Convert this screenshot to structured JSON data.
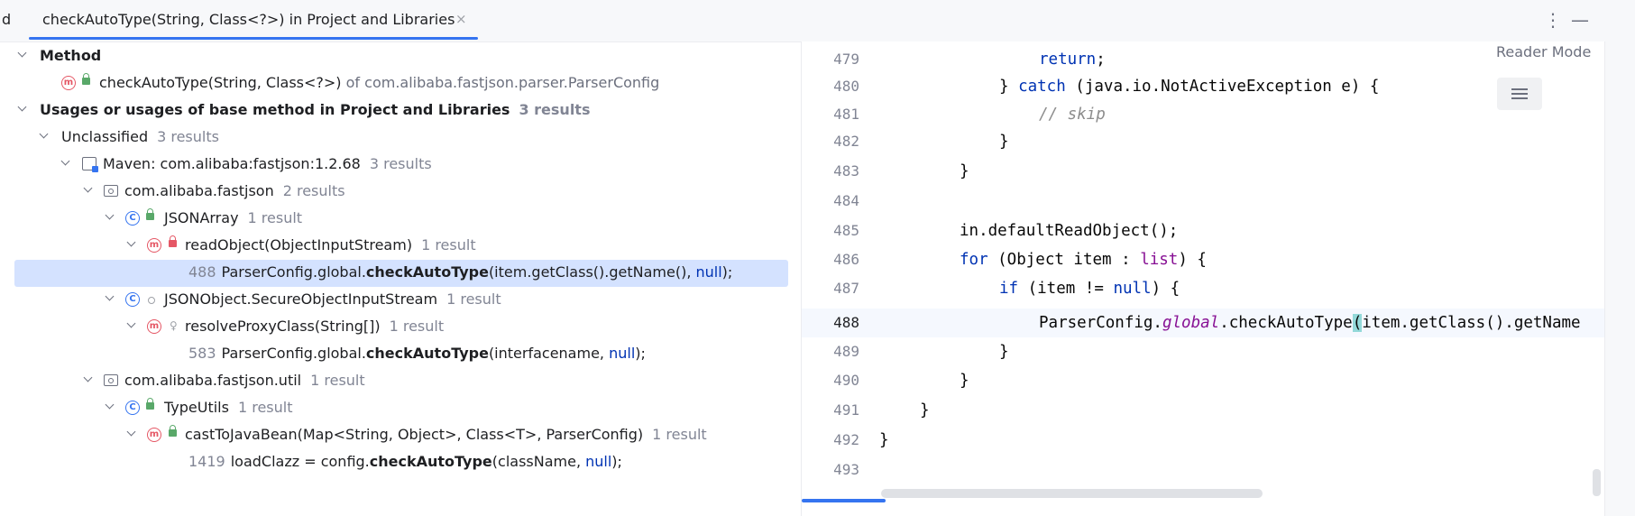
{
  "tab": {
    "prefix": "d",
    "title": "checkAutoType(String, Class<?>) in Project and Libraries",
    "close": "×"
  },
  "toolbar": {
    "more": "⋮",
    "minimize": "—"
  },
  "tree": {
    "method_header": "Method",
    "method_name": "checkAutoType(String, Class<?>)",
    "method_of": "of com.alibaba.fastjson.parser.ParserConfig",
    "usages_header": "Usages or usages of base method in Project and Libraries",
    "usages_count": "3 results",
    "unclassified": "Unclassified",
    "unclassified_count": "3 results",
    "maven": "Maven: com.alibaba:fastjson:1.2.68",
    "maven_count": "3 results",
    "pkg1": "com.alibaba.fastjson",
    "pkg1_count": "2 results",
    "class1": "JSONArray",
    "class1_count": "1 result",
    "method1": "readObject(ObjectInputStream)",
    "method1_count": "1 result",
    "usage1_line": "488",
    "usage1_pre": "ParserConfig.global.",
    "usage1_call": "checkAutoType",
    "usage1_args": "(item.getClass().getName(), ",
    "usage1_null": "null",
    "usage1_end": ");",
    "class2": "JSONObject.SecureObjectInputStream",
    "class2_count": "1 result",
    "method2": "resolveProxyClass(String[])",
    "method2_count": "1 result",
    "usage2_line": "583",
    "usage2_pre": "ParserConfig.global.",
    "usage2_call": "checkAutoType",
    "usage2_args": "(interfacename, ",
    "usage2_null": "null",
    "usage2_end": ");",
    "pkg2": "com.alibaba.fastjson.util",
    "pkg2_count": "1 result",
    "class3": "TypeUtils",
    "class3_count": "1 result",
    "method3": "castToJavaBean(Map<String, Object>, Class<T>, ParserConfig)",
    "method3_count": "1 result",
    "usage3_line": "1419",
    "usage3_pre": "loadClazz = config.",
    "usage3_call": "checkAutoType",
    "usage3_args": "(className, ",
    "usage3_null": "null",
    "usage3_end": ");"
  },
  "editor": {
    "reader_mode": "Reader Mode",
    "lines": [
      "479",
      "480",
      "481",
      "482",
      "483",
      "484",
      "485",
      "486",
      "487",
      "488",
      "489",
      "490",
      "491",
      "492",
      "493"
    ],
    "current_line": "488",
    "code": {
      "l479_a": "return",
      "l479_b": ";",
      "l480_a": "} ",
      "l480_b": "catch",
      "l480_c": " (java.io.NotActiveException e) {",
      "l481": "// skip",
      "l482": "}",
      "l483": "}",
      "l485": "in.defaultReadObject();",
      "l486_a": "for",
      "l486_b": " (Object item : ",
      "l486_c": "list",
      "l486_d": ") {",
      "l487_a": "if",
      "l487_b": " (item != ",
      "l487_c": "null",
      "l487_d": ") {",
      "l488_a": "ParserConfig.",
      "l488_b": "global",
      "l488_c": ".checkAutoType",
      "l488_d": "(",
      "l488_e": "item.getClass().getName",
      "l489": "}",
      "l490": "}",
      "l491": "}",
      "l492": "}"
    }
  },
  "colors": {
    "accent": "#3574f0",
    "selection": "#d4e2ff",
    "keyword": "#0033b3",
    "field": "#871094"
  }
}
